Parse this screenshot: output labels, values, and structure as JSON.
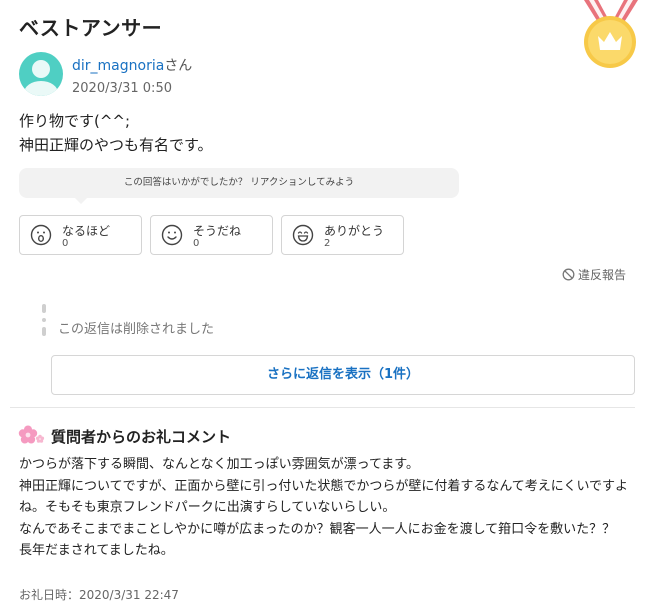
{
  "title": "ベストアンサー",
  "answer": {
    "user_name": "dir_magnoria",
    "user_suffix": "さん",
    "date": "2020/3/31 0:50",
    "body": "作り物です(^^;\n神田正輝のやつも有名です。"
  },
  "reaction_prompt": "この回答はいかがでしたか？ リアクションしてみよう",
  "reactions": [
    {
      "label": "なるほど",
      "count": "0",
      "icon": "surprised-face-icon"
    },
    {
      "label": "そうだね",
      "count": "0",
      "icon": "smile-face-icon"
    },
    {
      "label": "ありがとう",
      "count": "2",
      "icon": "grin-face-icon"
    }
  ],
  "report_label": "違反報告",
  "deleted_reply": "この返信は削除されました",
  "more_replies_label": "さらに返信を表示（1件）",
  "thanks": {
    "title": "質問者からのお礼コメント",
    "body": "かつらが落下する瞬間、なんとなく加工っぽい雰囲気が漂ってます。\n神田正輝についてですが、正面から壁に引っ付いた状態でかつらが壁に付着するなんて考えにくいですよね。そもそも東京フレンドパークに出演すらしていないらしい。\nなんであそこまでまことしやかに噂が広まったのか？観客一人一人にお金を渡して箝口令を敷いた？？\n長年だまされてましたね。",
    "date": "お礼日時：2020/3/31 22:47"
  },
  "colors": {
    "link": "#1971c2",
    "avatar": "#4fcfc3",
    "medal_gold": "#f7c948",
    "ribbon": "#e8737c",
    "flower": "#f59ac0"
  }
}
